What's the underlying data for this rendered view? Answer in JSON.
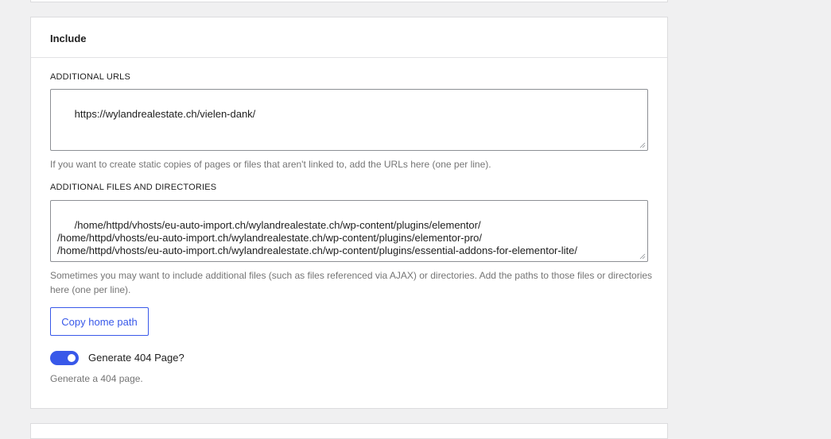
{
  "section": {
    "title": "Include"
  },
  "additional_urls": {
    "label": "ADDITIONAL URLS",
    "value": "https://wylandrealestate.ch/vielen-dank/",
    "help": "If you want to create static copies of pages or files that aren't linked to, add the URLs here (one per line)."
  },
  "additional_files": {
    "label": "ADDITIONAL FILES AND DIRECTORIES",
    "value": "/home/httpd/vhosts/eu-auto-import.ch/wylandrealestate.ch/wp-content/plugins/elementor/\n/home/httpd/vhosts/eu-auto-import.ch/wylandrealestate.ch/wp-content/plugins/elementor-pro/\n/home/httpd/vhosts/eu-auto-import.ch/wylandrealestate.ch/wp-content/plugins/essential-addons-for-elementor-lite/",
    "help": "Sometimes you may want to include additional files (such as files referenced via AJAX) or directories. Add the paths to those files or directories here (one per line)."
  },
  "copy_home_path": {
    "label": "Copy home path"
  },
  "generate_404": {
    "label": "Generate 404 Page?",
    "checked": true,
    "help": "Generate a 404 page."
  },
  "colors": {
    "accent": "#3858e9",
    "help_text": "#757575",
    "border": "#8c8f94",
    "background": "#f0f0f1"
  }
}
